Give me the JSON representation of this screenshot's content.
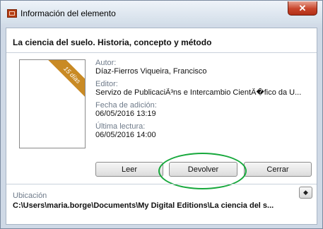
{
  "window": {
    "title": "Información del elemento",
    "close_glyph": "✕"
  },
  "item": {
    "title": "La ciencia del suelo. Historia, concepto y método",
    "badge": "15 días",
    "author_label": "Autor:",
    "author": "Díaz-Fierros Viqueira, Francisco",
    "publisher_label": "Editor:",
    "publisher": "Servizo de PublicaciÃ³ns e Intercambio CientÃ�fico da U...",
    "added_label": "Fecha de adición:",
    "added": "06/05/2016 13:19",
    "last_read_label": "Última lectura:",
    "last_read": "06/05/2016 14:00"
  },
  "buttons": {
    "read": "Leer",
    "return": "Devolver",
    "close": "Cerrar"
  },
  "location": {
    "label": "Ubicación",
    "button_glyph": "◆",
    "path": "C:\\Users\\maria.borge\\Documents\\My Digital Editions\\La ciencia del s..."
  },
  "colors": {
    "highlight": "#17a83c",
    "badge": "#c98a24",
    "close": "#c8442a"
  }
}
